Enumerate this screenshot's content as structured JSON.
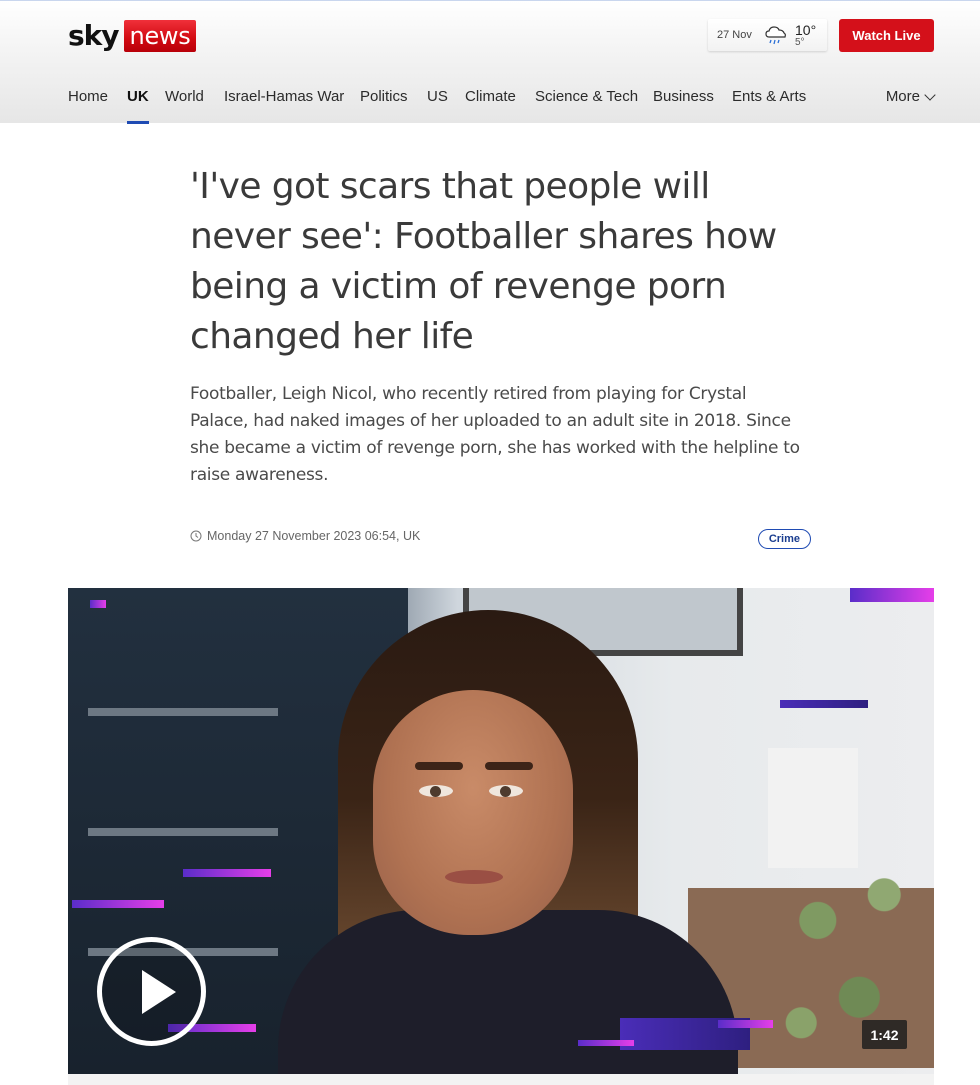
{
  "header": {
    "logo_sky": "sky",
    "logo_news": "news",
    "weather": {
      "date": "27 Nov",
      "high": "10°",
      "low": "5°",
      "icon": "rain-cloud-icon"
    },
    "watch_live_label": "Watch Live",
    "nav": {
      "items": [
        {
          "label": "Home"
        },
        {
          "label": "UK",
          "active": true
        },
        {
          "label": "World"
        },
        {
          "label": "Israel-Hamas War"
        },
        {
          "label": "Politics"
        },
        {
          "label": "US"
        },
        {
          "label": "Climate"
        },
        {
          "label": "Science & Tech"
        },
        {
          "label": "Business"
        },
        {
          "label": "Ents & Arts"
        }
      ],
      "more_label": "More"
    }
  },
  "article": {
    "headline": "'I've got scars that people will never see': Footballer shares how being a victim of revenge porn changed her life",
    "standfirst": "Footballer, Leigh Nicol, who recently retired from playing for Crystal Palace, had naked images of her uploaded to an adult site in 2018. Since she became a victim of revenge porn, she has worked with the helpline to raise awareness.",
    "date": "Monday 27 November 2023 06:54, UK",
    "tag": "Crime"
  },
  "video": {
    "duration": "1:42"
  },
  "colors": {
    "brand_red": "#d4101a",
    "nav_active_underline": "#1f4bb3",
    "tag_blue": "#1a3d8f"
  }
}
